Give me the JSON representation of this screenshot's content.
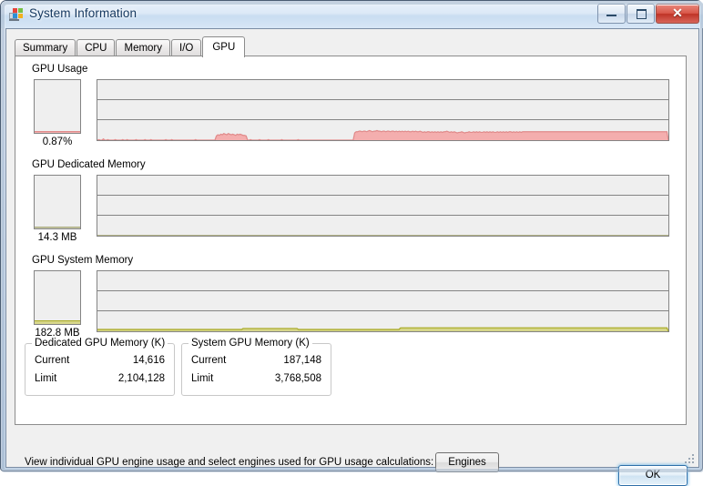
{
  "window": {
    "title": "System Information",
    "icon": "system-information-icon",
    "controls": {
      "minimize": "minimize-icon",
      "maximize": "maximize-icon",
      "close_label": "✕"
    }
  },
  "tabs": [
    {
      "label": "Summary",
      "active": false
    },
    {
      "label": "CPU",
      "active": false
    },
    {
      "label": "Memory",
      "active": false
    },
    {
      "label": "I/O",
      "active": false
    },
    {
      "label": "GPU",
      "active": true
    }
  ],
  "sections": [
    {
      "label": "GPU Usage",
      "meter_value": "0.87%",
      "meter_fill_pct": 0.87,
      "color": "#f4aeae",
      "line_color": "#e08a8a"
    },
    {
      "label": "GPU Dedicated Memory",
      "meter_value": "14.3 MB",
      "meter_fill_pct": 0.7,
      "color": "#c9cbb0",
      "line_color": "#a9aa7a"
    },
    {
      "label": "GPU System Memory",
      "meter_value": "182.8 MB",
      "meter_fill_pct": 4.8,
      "color": "#d6d68a",
      "line_color": "#a7a820"
    }
  ],
  "chart_data": [
    {
      "type": "area",
      "title": "GPU Usage",
      "ylabel": "%",
      "ylim": [
        0,
        100
      ],
      "grid": true,
      "gridlines": 2,
      "current_value": 0.87,
      "unit": "%",
      "color": "#f4aeae",
      "values": [
        0,
        1,
        0,
        0,
        2,
        0,
        0,
        1,
        0,
        0,
        0,
        0,
        1,
        0,
        0,
        0,
        0,
        1,
        0,
        0,
        1,
        0,
        0,
        0,
        0,
        0,
        1,
        0,
        0,
        0,
        0,
        0,
        1,
        0,
        0,
        0,
        1,
        0,
        0,
        0,
        0,
        0,
        0,
        0,
        0,
        0,
        1,
        0,
        0,
        0,
        1,
        0,
        0,
        0,
        0,
        0,
        0,
        0,
        0,
        0,
        0,
        0,
        0,
        0,
        0,
        0,
        1,
        0,
        0,
        0,
        0,
        0,
        0,
        0,
        0,
        0,
        0,
        0,
        0,
        0,
        7,
        9,
        8,
        10,
        9,
        11,
        10,
        9,
        11,
        10,
        9,
        10,
        9,
        8,
        10,
        9,
        10,
        9,
        8,
        8,
        7,
        0,
        0,
        1,
        0,
        0,
        0,
        0,
        0,
        1,
        0,
        0,
        0,
        0,
        0,
        1,
        0,
        0,
        0,
        0,
        0,
        0,
        0,
        0,
        1,
        0,
        0,
        0,
        0,
        0,
        0,
        0,
        0,
        0,
        0,
        1,
        0,
        0,
        0,
        0,
        0,
        0,
        0,
        0,
        0,
        0,
        0,
        0,
        0,
        0,
        0,
        0,
        0,
        0,
        0,
        0,
        0,
        0,
        0,
        0,
        0,
        0,
        0,
        0,
        0,
        0,
        0,
        0,
        0,
        0,
        0,
        0,
        0,
        12,
        14,
        14,
        15,
        15,
        14,
        15,
        15,
        14,
        15,
        16,
        15,
        14,
        15,
        15,
        16,
        15,
        15,
        14,
        15,
        15,
        14,
        15,
        15,
        14,
        15,
        15,
        14,
        15,
        14,
        15,
        14,
        15,
        14,
        15,
        14,
        15,
        14,
        14,
        15,
        14,
        15,
        14,
        14,
        15,
        14,
        13,
        14,
        13,
        14,
        14,
        13,
        14,
        13,
        14,
        13,
        14,
        13,
        14,
        13,
        14,
        14,
        15,
        14,
        13,
        14,
        13,
        14,
        13,
        12,
        13,
        13,
        14,
        13,
        12,
        13,
        13,
        14,
        13,
        13,
        14,
        13,
        14,
        13,
        14,
        13,
        13,
        14,
        13,
        14,
        13,
        14,
        13,
        14,
        13,
        13,
        14,
        13,
        14,
        13,
        14,
        13,
        14,
        13,
        14,
        14,
        13,
        14,
        13,
        14,
        13,
        14,
        13,
        14,
        14,
        14,
        14,
        14,
        14,
        14,
        14,
        14,
        14,
        14,
        14,
        14,
        14,
        14,
        14,
        14,
        14,
        14,
        14,
        14,
        14,
        14,
        14,
        14,
        14,
        14,
        14,
        14,
        14,
        14,
        14,
        14,
        14,
        14,
        14,
        14,
        14,
        14,
        14,
        14,
        14,
        14,
        14,
        14,
        14,
        14,
        14,
        14,
        14,
        14,
        14,
        14,
        14,
        14,
        14,
        14,
        14,
        14,
        14,
        14,
        14,
        14,
        14,
        14,
        14,
        14,
        14,
        14,
        14,
        14,
        14,
        14,
        14,
        14,
        14,
        14,
        14,
        14,
        14,
        14,
        14,
        14,
        14,
        14,
        14,
        14,
        14,
        14,
        14,
        14,
        14,
        14,
        14,
        14,
        14,
        14,
        14,
        0
      ]
    },
    {
      "type": "area",
      "title": "GPU Dedicated Memory",
      "ylabel": "MB",
      "grid": true,
      "gridlines": 2,
      "current_value": 14.3,
      "unit": "MB",
      "color": "#c9cbb0",
      "values": [
        0.4,
        0.4,
        0.4,
        0.4,
        0.4,
        0.4,
        0.4,
        0.4,
        0.4,
        0.4,
        0.4,
        0.4,
        0.4,
        0.4,
        0.4,
        0.4,
        0.4,
        0.4,
        0.4,
        0.4,
        0.4,
        0.4,
        0.4,
        0.4,
        0.4,
        0.4,
        0.4,
        0.4,
        0.4,
        0.4,
        0.4,
        0.4,
        0.4,
        0.4,
        0.4,
        0.4,
        0.4,
        0.4,
        0.4,
        0.4,
        0.4,
        0.4,
        0.4,
        0.4,
        0.4,
        0.4,
        0.4,
        0.4,
        0.4,
        0.4,
        0.4,
        0.4,
        0.4,
        0.4,
        0.4,
        0.4,
        0.4,
        0.4,
        0.4,
        0.4,
        0.4,
        0.4,
        0.4,
        0.4,
        0.4,
        0.4,
        0.4,
        0.4,
        0.4,
        0.4,
        0.4,
        0.4,
        0.4,
        0.4,
        0.4,
        0.4,
        0.4,
        0.4,
        0.4,
        0.4
      ]
    },
    {
      "type": "area",
      "title": "GPU System Memory",
      "ylabel": "MB",
      "grid": true,
      "gridlines": 2,
      "current_value": 182.8,
      "unit": "MB",
      "color": "#d6d68a",
      "values": [
        3,
        3,
        3,
        3,
        3,
        3,
        3,
        3,
        3,
        3,
        3,
        3,
        3,
        3,
        3,
        3,
        3,
        3,
        3,
        3,
        3,
        3,
        3,
        3,
        3,
        3,
        3,
        3,
        3,
        3,
        3,
        3,
        3,
        3,
        3,
        3,
        3,
        3,
        3,
        3,
        3,
        3,
        3,
        3,
        3,
        3,
        3,
        3,
        3,
        3,
        3,
        3,
        3,
        3,
        3,
        3,
        3,
        3,
        3,
        3,
        3,
        3,
        3,
        3,
        3,
        3,
        3,
        3,
        3,
        3,
        3,
        3,
        3,
        3,
        3,
        3,
        3,
        3,
        3,
        3,
        3,
        3,
        3,
        3,
        3,
        3,
        3,
        3,
        3,
        3,
        3,
        3,
        3,
        3,
        3,
        3,
        3,
        3,
        3,
        3,
        4.6,
        4.6,
        4.6,
        4.6,
        4.6,
        4.6,
        4.6,
        4.6,
        4.6,
        4.6,
        4.6,
        4.6,
        4.6,
        4.6,
        4.6,
        4.6,
        4.6,
        4.6,
        4.6,
        4.6,
        4.6,
        4.6,
        4.6,
        4.6,
        4.6,
        4.6,
        4.6,
        4.6,
        4.6,
        4.6,
        4.6,
        4.6,
        4.6,
        4.6,
        4.6,
        4.6,
        4.6,
        4.6,
        3,
        3,
        3,
        3,
        3,
        3,
        3,
        3,
        3,
        3,
        3,
        3,
        3,
        3,
        3,
        3,
        3,
        3,
        3,
        3,
        3,
        3,
        3,
        3,
        3,
        3,
        3,
        3,
        3,
        3,
        3,
        3,
        3,
        3,
        3,
        3,
        3,
        3,
        3,
        3,
        3,
        3,
        3,
        3,
        3,
        3,
        3,
        3,
        3,
        3,
        3,
        3,
        3,
        3,
        3,
        3,
        3,
        3,
        3,
        3,
        3,
        3,
        3,
        3,
        3,
        3,
        3,
        3,
        3,
        3,
        5.6,
        5.8,
        5.8,
        5.8,
        5.8,
        5.8,
        5.8,
        5.8,
        5.8,
        5.8,
        5.8,
        5.8,
        5.8,
        5.8,
        5.8,
        5.8,
        5.8,
        5.8,
        5.8,
        5.8,
        5.8,
        5.8,
        5.8,
        5.8,
        5.8,
        5.8,
        5.8,
        5.8,
        5.8,
        5.8,
        5.8,
        5.8,
        5.8,
        5.8,
        5.8,
        5.8,
        5.8,
        5.8,
        5.8,
        5.8,
        5.8,
        5.8,
        5.8,
        5.8,
        5.8,
        5.8,
        5.8,
        5.8,
        5.8,
        5.8,
        5.8,
        5.8,
        5.8,
        5.8,
        5.8,
        5.8,
        5.8,
        5.8,
        5.8,
        5.8,
        5.8,
        5.8,
        5.8,
        5.8,
        5.8,
        5.8,
        5.8,
        5.8,
        5.8,
        5.8,
        5.8,
        5.8,
        5.8,
        5.8,
        5.8,
        5.8,
        5.8,
        5.8,
        5.8,
        5.8,
        5.8,
        5.8,
        5.8,
        5.8,
        5.8,
        5.8,
        5.8,
        5.8,
        5.8,
        5.8,
        5.8,
        5.8,
        5.8,
        5.8,
        5.8,
        5.8,
        5.8,
        5.8,
        5.8,
        5.8,
        5.8,
        5.8,
        5.8,
        5.8,
        5.8,
        5.8,
        5.8,
        5.8,
        5.8,
        5.8,
        5.8,
        5.8,
        5.8,
        5.8,
        5.8,
        5.8,
        5.8,
        5.8,
        5.8,
        5.8,
        5.8,
        5.8,
        5.8,
        5.8,
        5.8,
        5.8,
        5.8,
        5.8,
        5.8,
        5.8,
        5.8,
        5.8,
        5.8,
        5.8,
        5.8,
        5.8,
        5.8,
        5.8,
        5.8,
        5.8,
        5.8,
        5.8,
        5.8,
        5.8,
        5.8,
        5.8,
        5.8,
        5.8,
        5.8,
        5.8,
        5.8,
        5.8,
        5.8,
        5.8,
        5.8,
        5.8,
        5.8,
        5.8,
        5.8,
        5.8,
        5.8,
        5.8,
        5.8,
        5.8,
        5.8,
        5.8,
        5.8,
        5.8,
        5.8,
        5.8,
        5.8,
        5.8,
        5.8,
        5.8,
        5.8,
        5.8,
        5.8,
        5.8,
        5.8,
        5.8,
        5.8,
        5.8,
        5.8,
        5.8,
        0
      ]
    }
  ],
  "dedicated_box": {
    "title": "Dedicated GPU Memory (K)",
    "rows": [
      {
        "key": "Current",
        "value": "14,616"
      },
      {
        "key": "Limit",
        "value": "2,104,128"
      }
    ]
  },
  "system_box": {
    "title": "System GPU Memory (K)",
    "rows": [
      {
        "key": "Current",
        "value": "187,148"
      },
      {
        "key": "Limit",
        "value": "3,768,508"
      }
    ]
  },
  "footer": {
    "note": "View individual GPU engine usage and select engines used for GPU usage calculations:",
    "engines_label": "Engines",
    "ok_label": "OK"
  }
}
